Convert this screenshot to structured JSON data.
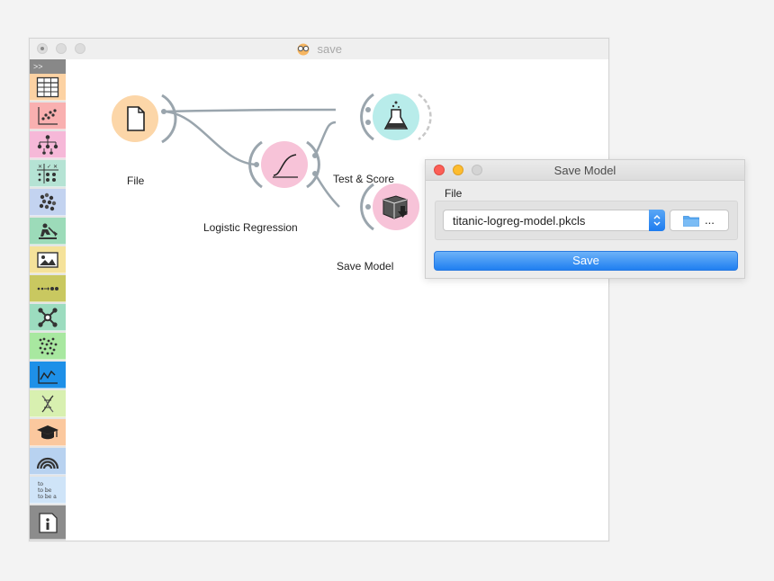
{
  "window": {
    "title": "save",
    "title_icon": "glasses-owl-icon"
  },
  "toolbox": {
    "toggle_label": ">>",
    "categories": [
      {
        "icon": "data-table-icon",
        "color": "#fcd2a3"
      },
      {
        "icon": "scatter-plot-icon",
        "color": "#f9b0b0"
      },
      {
        "icon": "tree-icon",
        "color": "#f6b8d8"
      },
      {
        "icon": "confusion-matrix-icon",
        "color": "#b5e3d4"
      },
      {
        "icon": "clustering-icon",
        "color": "#c3d3f0"
      },
      {
        "icon": "mining-icon",
        "color": "#9cdbb9"
      },
      {
        "icon": "image-icon",
        "color": "#f5e29a"
      },
      {
        "icon": "timeseries-icon",
        "color": "#c9c860"
      },
      {
        "icon": "network-icon",
        "color": "#9cdcbf"
      },
      {
        "icon": "single-cell-icon",
        "color": "#a8e8a0"
      },
      {
        "icon": "line-chart-icon",
        "color": "#1e90e8"
      },
      {
        "icon": "bioinformatics-icon",
        "color": "#d8f0b0"
      },
      {
        "icon": "education-icon",
        "color": "#fbc89e"
      },
      {
        "icon": "spectroscopy-icon",
        "color": "#b8d2f0"
      },
      {
        "icon": "text-mining-icon",
        "color": "#cfe4f8"
      },
      {
        "icon": "info-icon",
        "color": "#8c8c8c"
      }
    ],
    "text_mining_lines": [
      "to",
      "to be",
      "to be a"
    ]
  },
  "workflow": {
    "nodes": [
      {
        "id": "file",
        "label": "File",
        "icon": "file-icon",
        "color": "#fcd6a8"
      },
      {
        "id": "logreg",
        "label": "Logistic Regression",
        "icon": "sigmoid-icon",
        "color": "#f7c3d8"
      },
      {
        "id": "testscore",
        "label": "Test & Score",
        "icon": "flask-icon",
        "color": "#b8ecea"
      },
      {
        "id": "savemodel",
        "label": "Save Model",
        "icon": "save-model-icon",
        "color": "#f7c3d8"
      }
    ]
  },
  "dialog": {
    "title": "Save Model",
    "file_group_label": "File",
    "selected_file": "titanic-logreg-model.pkcls",
    "browse_label": "...",
    "save_label": "Save",
    "colors": {
      "close": "#fc5f57",
      "minimize": "#fdbc2e",
      "maximize": "#d4d4d4",
      "accent": "#1f7ff1"
    }
  }
}
